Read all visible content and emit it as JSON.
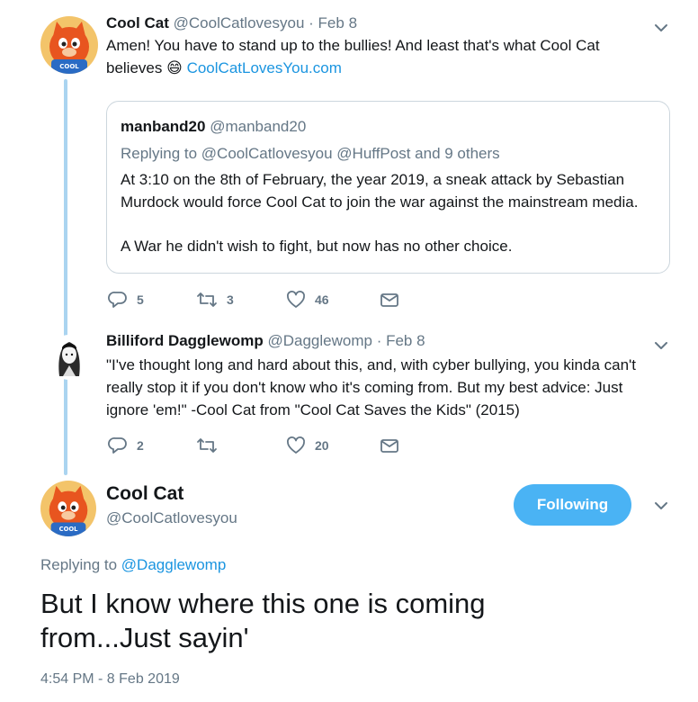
{
  "tweet1": {
    "name": "Cool Cat",
    "handle": "@CoolCatlovesyou",
    "sep": "·",
    "date": "Feb 8",
    "text_line1": "Amen! You have to stand up to the bullies!  And least that's what Cool Cat",
    "text_line2_pre": "believes",
    "emoji": "😄",
    "link": "CoolCatLovesYou.com",
    "avatar_badge": "COOL CAT",
    "quote": {
      "name": "manband20",
      "handle": "@manband20",
      "replying_prefix": "Replying to",
      "replying_targets": "@CoolCatlovesyou @HuffPost and 9 others",
      "line1": "At 3:10 on the 8th of February, the year 2019, a sneak attack by Sebastian",
      "line2": "Murdock would force Cool Cat to join the war against the mainstream media.",
      "line3": "A War he didn't wish to fight, but now has no other choice."
    },
    "replies": "5",
    "retweets": "3",
    "likes": "46"
  },
  "tweet2": {
    "name": "Billiford Dagglewomp",
    "handle": "@Dagglewomp",
    "sep": "·",
    "date": "Feb 8",
    "line1": "\"I've thought long and hard about this, and, with cyber bullying, you kinda can't",
    "line2": "really stop it if you don't know who it's coming from. But my best advice: Just",
    "line3": "ignore 'em!\" -Cool Cat from \"Cool Cat Saves the Kids\" (2015)",
    "replies": "2",
    "retweets": "",
    "likes": "20"
  },
  "main": {
    "name": "Cool Cat",
    "handle": "@CoolCatlovesyou",
    "follow_label": "Following",
    "replying_prefix": "Replying to",
    "replying_to": "@Dagglewomp",
    "line1": "But I know where this one is coming",
    "line2": "from...Just sayin'",
    "timestamp": "4:54 PM - 8 Feb 2019",
    "avatar_badge": "COOL CAT"
  },
  "colors": {
    "accent": "#1b95e0",
    "follow_bg": "#4ab3f4",
    "thread_line": "#aad4f0",
    "muted": "#657786"
  },
  "icons": [
    "reply-icon",
    "retweet-icon",
    "like-icon",
    "dm-icon",
    "chevron-down-icon"
  ]
}
